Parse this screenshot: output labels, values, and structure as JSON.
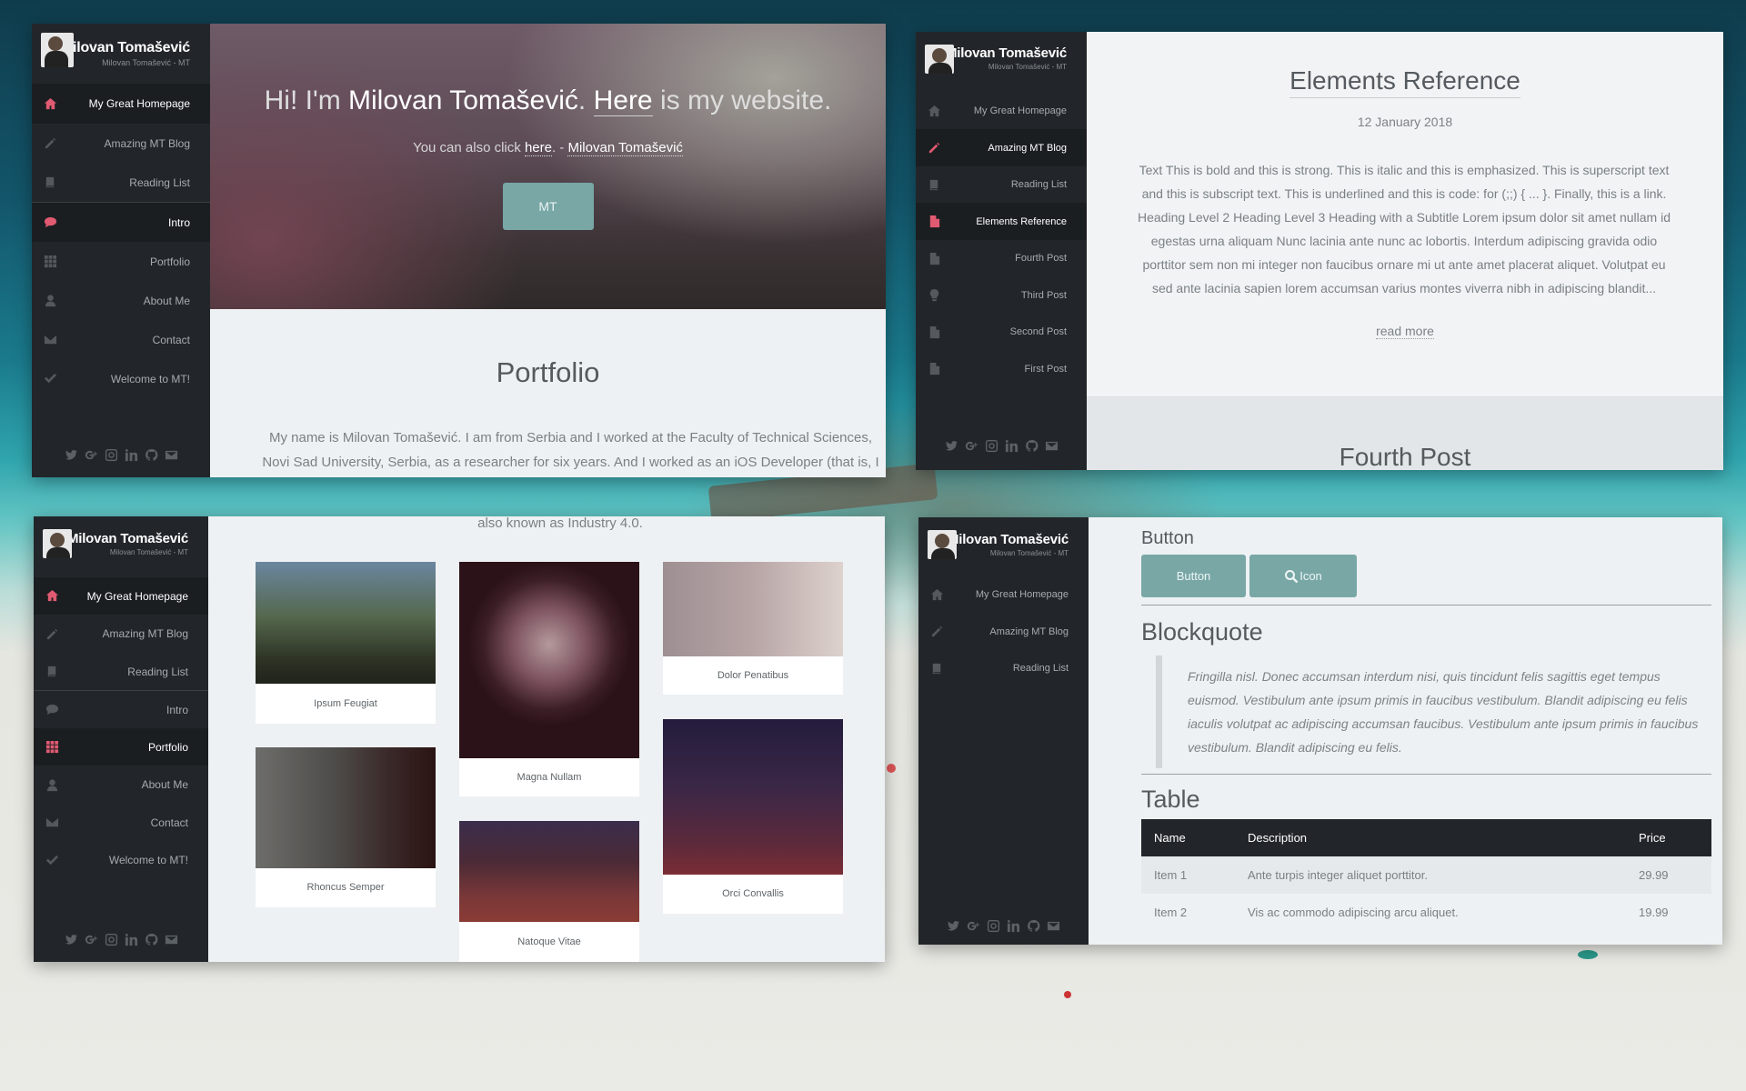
{
  "site": {
    "name": "Milovan Tomašević",
    "subtitle": "Milovan Tomašević - MT"
  },
  "panel1": {
    "nav": [
      {
        "label": "My Great Homepage",
        "icon": "home-icon"
      },
      {
        "label": "Amazing MT Blog",
        "icon": "pencil-icon"
      },
      {
        "label": "Reading List",
        "icon": "book-icon"
      },
      {
        "label": "Intro",
        "icon": "speech-bubble-icon"
      },
      {
        "label": "Portfolio",
        "icon": "grid-icon"
      },
      {
        "label": "About Me",
        "icon": "user-icon"
      },
      {
        "label": "Contact",
        "icon": "envelope-icon"
      },
      {
        "label": "Welcome to MT!",
        "icon": "check-icon"
      }
    ],
    "hero": {
      "part1": "Hi! I'm ",
      "name": "Milovan Tomašević",
      "part2": ". ",
      "here": "Here",
      "part3": " is my website.",
      "line_pre": "You can also click ",
      "line_link": "here",
      "line_mid": ". - ",
      "line_name": "Milovan Tomašević",
      "button": "MT"
    },
    "section_title": "Portfolio",
    "section_text": "My name is Milovan Tomašević. I am from Serbia and I worked at the Faculty of Technical Sciences, Novi Sad University, Serbia, as a researcher for six years. And I worked as an iOS Developer (that is, I"
  },
  "panel2": {
    "nav": [
      {
        "label": "My Great Homepage",
        "icon": "home-icon"
      },
      {
        "label": "Amazing MT Blog",
        "icon": "pencil-icon"
      },
      {
        "label": "Reading List",
        "icon": "book-icon"
      },
      {
        "label": "Elements Reference",
        "icon": "document-icon"
      },
      {
        "label": "Fourth Post",
        "icon": "document-icon"
      },
      {
        "label": "Third Post",
        "icon": "lightbulb-icon"
      },
      {
        "label": "Second Post",
        "icon": "document-icon"
      },
      {
        "label": "First Post",
        "icon": "document-icon"
      }
    ],
    "post_title": "Elements Reference",
    "post_date": "12 January 2018",
    "post_excerpt": "Text This is bold and this is strong. This is italic and this is emphasized. This is superscript text and this is subscript text. This is underlined and this is code: for (;;) { ... }. Finally, this is a link. Heading Level 2 Heading Level 3 Heading with a Subtitle Lorem ipsum dolor sit amet nullam id egestas urna aliquam Nunc lacinia ante nunc ac lobortis. Interdum adipiscing gravida odio porttitor sem non mi integer non faucibus ornare mi ut ante amet placerat aliquet. Volutpat eu sed ante lacinia sapien lorem accumsan varius montes viverra nibh in adipiscing blandit...",
    "read_more": "read more",
    "next_title": "Fourth Post"
  },
  "panel3": {
    "nav": [
      {
        "label": "My Great Homepage",
        "icon": "home-icon"
      },
      {
        "label": "Amazing MT Blog",
        "icon": "pencil-icon"
      },
      {
        "label": "Reading List",
        "icon": "book-icon"
      },
      {
        "label": "Intro",
        "icon": "speech-bubble-icon"
      },
      {
        "label": "Portfolio",
        "icon": "grid-icon"
      },
      {
        "label": "About Me",
        "icon": "user-icon"
      },
      {
        "label": "Contact",
        "icon": "envelope-icon"
      },
      {
        "label": "Welcome to MT!",
        "icon": "check-icon"
      }
    ],
    "top_text": "also known as Industry 4.0.",
    "tiles": [
      {
        "caption": "Ipsum Feugiat"
      },
      {
        "caption": "Rhoncus Semper"
      },
      {
        "caption": "Magna Nullam"
      },
      {
        "caption": "Natoque Vitae"
      },
      {
        "caption": "Dolor Penatibus"
      },
      {
        "caption": "Orci Convallis"
      }
    ]
  },
  "panel4": {
    "nav": [
      {
        "label": "My Great Homepage",
        "icon": "home-icon"
      },
      {
        "label": "Amazing MT Blog",
        "icon": "pencil-icon"
      },
      {
        "label": "Reading List",
        "icon": "book-icon"
      }
    ],
    "button_heading": "Button",
    "button_label": "Button",
    "icon_button_label": "Icon",
    "blockquote_heading": "Blockquote",
    "blockquote_text": "Fringilla nisl. Donec accumsan interdum nisi, quis tincidunt felis sagittis eget tempus euismod. Vestibulum ante ipsum primis in faucibus vestibulum. Blandit adipiscing eu felis iaculis volutpat ac adipiscing accumsan faucibus. Vestibulum ante ipsum primis in faucibus vestibulum. Blandit adipiscing eu felis.",
    "table_heading": "Table",
    "table": {
      "headers": [
        "Name",
        "Description",
        "Price"
      ],
      "rows": [
        [
          "Item 1",
          "Ante turpis integer aliquet porttitor.",
          "29.99"
        ],
        [
          "Item 2",
          "Vis ac commodo adipiscing arcu aliquet.",
          "19.99"
        ]
      ]
    }
  },
  "social_icons": [
    "twitter-icon",
    "google-plus-icon",
    "instagram-icon",
    "linkedin-icon",
    "github-icon",
    "envelope-icon"
  ],
  "colors": {
    "sidebar": "#22262a",
    "accent": "#e05a72",
    "button": "#78a7a6"
  }
}
